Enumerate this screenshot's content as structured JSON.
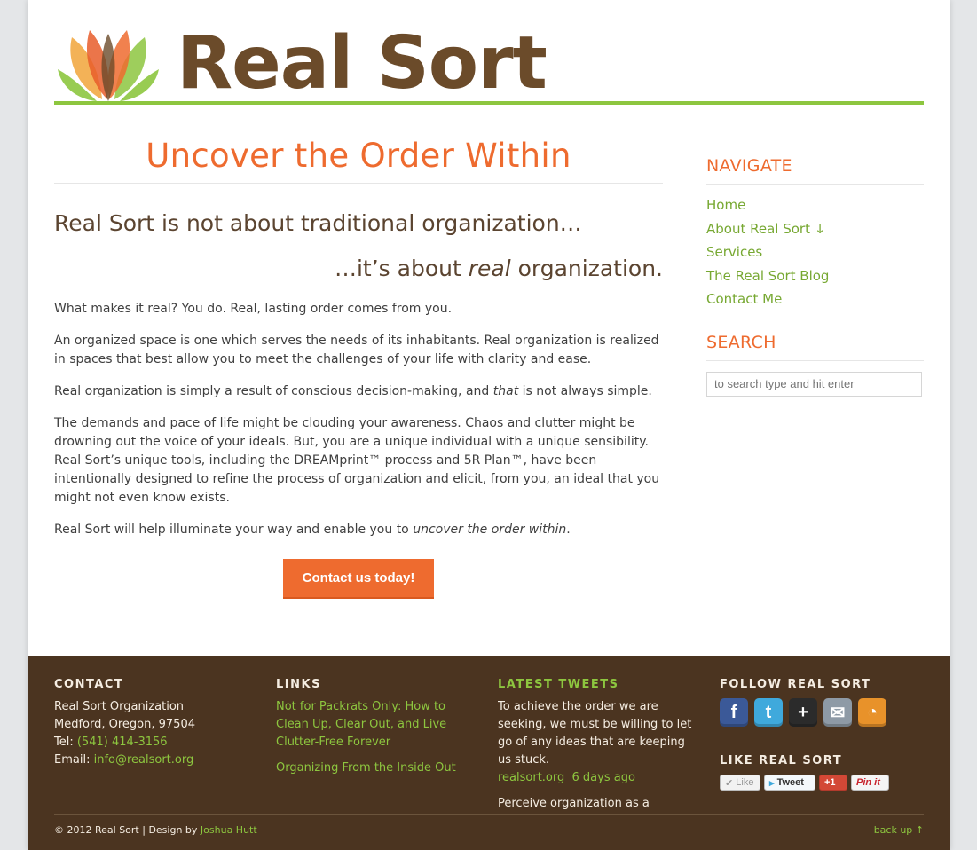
{
  "header": {
    "logo_text": "Real Sort"
  },
  "main": {
    "title": "Uncover the Order Within",
    "subhead1": "Real Sort is not about traditional organization…",
    "subhead2_pre": "…it’s about ",
    "subhead2_em": "real",
    "subhead2_post": " organization.",
    "p1": "What makes it real? You do. Real, lasting order comes from you.",
    "p2": "An organized space is one which serves the needs of its inhabitants. Real organization is realized in spaces that best allow you to meet the challenges of your life with clarity and ease.",
    "p3_pre": "Real organization is simply a result of conscious decision-making, and ",
    "p3_em": "that",
    "p3_post": " is not always simple.",
    "p4": "The demands and pace of life might be clouding your awareness. Chaos and clutter might be drowning out the voice of your ideals. But, you are a unique individual with a unique sensibility. Real Sort’s unique tools, including the DREAMprint™ process and 5R Plan™, have been intentionally designed to refine the process of organization and elicit, from you, an ideal that you might not even know exists.",
    "p5_pre": "Real Sort will help illuminate your way and enable you to ",
    "p5_em": "uncover the order within",
    "p5_post": ".",
    "cta_label": "Contact us today!"
  },
  "sidebar": {
    "nav_heading": "NAVIGATE",
    "nav_items": [
      {
        "label": "Home"
      },
      {
        "label": "About Real Sort ↓"
      },
      {
        "label": "Services"
      },
      {
        "label": "The Real Sort Blog"
      },
      {
        "label": "Contact Me"
      }
    ],
    "search_heading": "SEARCH",
    "search_placeholder": "to search type and hit enter"
  },
  "footer": {
    "contact": {
      "heading": "CONTACT",
      "org": "Real Sort Organization",
      "city": "Medford, Oregon, 97504",
      "tel_label": "Tel: ",
      "tel": "(541) 414-3156",
      "email_label": "Email: ",
      "email": "info@realsort.org"
    },
    "links": {
      "heading": "LINKS",
      "items": [
        {
          "label": "Not for Packrats Only: How to Clean Up, Clear Out, and Live Clutter-Free Forever"
        },
        {
          "label": "Organizing From the Inside Out"
        }
      ]
    },
    "tweets": {
      "heading": "LATEST TWEETS",
      "t1_text": "To achieve the order we are seeking, we must be willing to let go of any ideas that are keeping us stuck.",
      "t1_source": "realsort.org",
      "t1_time": "6 days ago",
      "t2_text": "Perceive organization as a dynamic process and allow for continual"
    },
    "follow": {
      "heading": "FOLLOW REAL SORT",
      "icons": [
        "facebook-icon",
        "twitter-icon",
        "google-plus-icon",
        "email-icon",
        "rss-icon"
      ],
      "like_heading": "LIKE REAL SORT",
      "like_label": "Like",
      "tweet_label": "Tweet",
      "gplus_label": "+1",
      "pin_label": "Pin it"
    },
    "copyright": "© 2012 Real Sort | Design by ",
    "designer": "Joshua Hutt",
    "back_up": "back up ↑"
  },
  "colors": {
    "accent_orange": "#ee6b2f",
    "accent_green": "#8dc63f",
    "brand_brown": "#6b4b2a",
    "footer_bg": "#4b3420"
  }
}
